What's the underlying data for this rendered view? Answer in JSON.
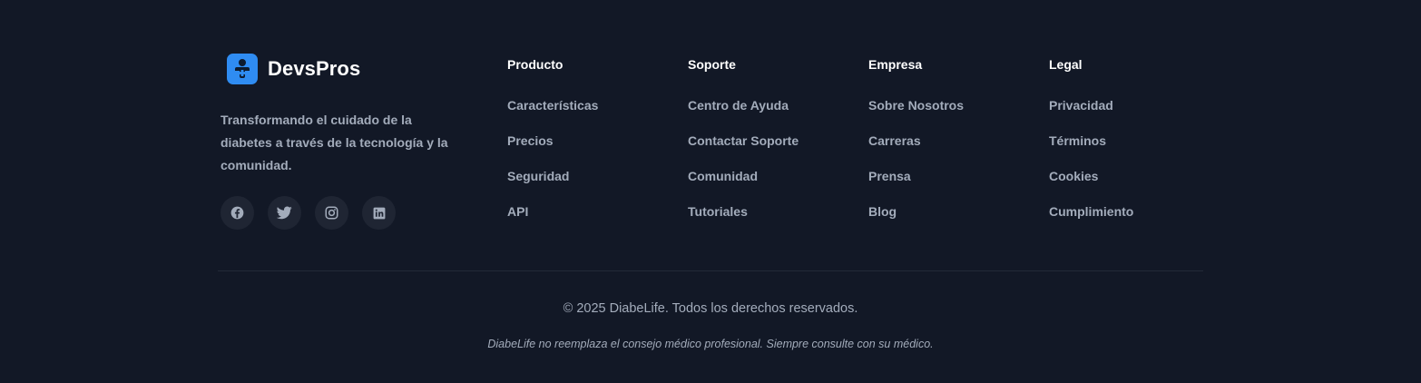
{
  "brand": {
    "name": "DevsPros",
    "tagline": "Transformando el cuidado de la diabetes a través de la tecnología y la comunidad.",
    "logo_icon": "user-plus-medical-icon",
    "accent_color": "#2f8cf2"
  },
  "socials": [
    {
      "name": "facebook",
      "icon": "facebook-icon"
    },
    {
      "name": "twitter",
      "icon": "twitter-icon"
    },
    {
      "name": "instagram",
      "icon": "instagram-icon"
    },
    {
      "name": "linkedin",
      "icon": "linkedin-icon"
    }
  ],
  "columns": [
    {
      "title": "Producto",
      "links": [
        "Características",
        "Precios",
        "Seguridad",
        "API"
      ]
    },
    {
      "title": "Soporte",
      "links": [
        "Centro de Ayuda",
        "Contactar Soporte",
        "Comunidad",
        "Tutoriales"
      ]
    },
    {
      "title": "Empresa",
      "links": [
        "Sobre Nosotros",
        "Carreras",
        "Prensa",
        "Blog"
      ]
    },
    {
      "title": "Legal",
      "links": [
        "Privacidad",
        "Términos",
        "Cookies",
        "Cumplimiento"
      ]
    }
  ],
  "footer": {
    "copyright": "© 2025 DiabeLife. Todos los derechos reservados.",
    "disclaimer": "DiabeLife no reemplaza el consejo médico profesional. Siempre consulte con su médico."
  },
  "colors": {
    "background": "#121826",
    "text_muted": "#a3acbb",
    "heading": "#ffffff",
    "social_bg": "#1f2533"
  }
}
